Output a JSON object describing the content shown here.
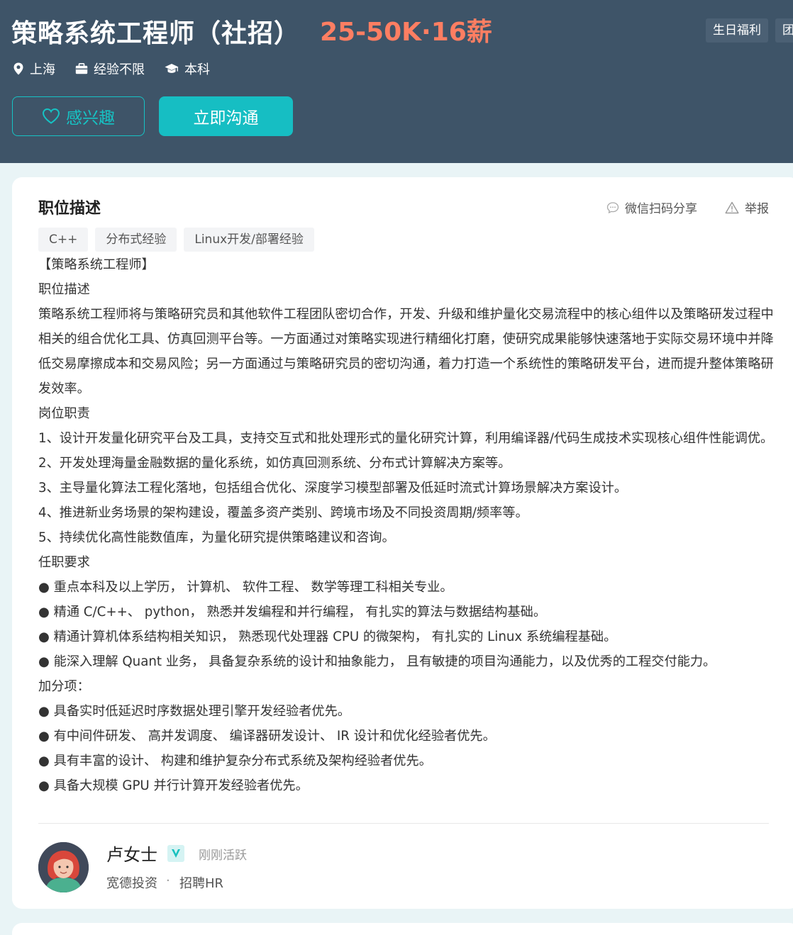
{
  "header": {
    "title": "策略系统工程师（社招）",
    "salary": "25-50K·16薪",
    "welfare_tags": [
      "生日福利",
      "团"
    ],
    "meta": {
      "location": "上海",
      "experience": "经验不限",
      "degree": "本科"
    },
    "buttons": {
      "interest": "感兴趣",
      "chat": "立即沟通"
    }
  },
  "job": {
    "section_title": "职位描述",
    "share": "微信扫码分享",
    "report": "举报",
    "skill_tags": [
      "C++",
      "分布式经验",
      "Linux开发/部署经验"
    ],
    "description": [
      "【策略系统工程师】",
      "职位描述",
      "策略系统工程师将与策略研究员和其他软件工程团队密切合作，开发、升级和维护量化交易流程中的核心组件以及策略研发过程中相关的组合优化工具、仿真回测平台等。一方面通过对策略实现进行精细化打磨，使研究成果能够快速落地于实际交易环境中并降低交易摩擦成本和交易风险；另一方面通过与策略研究员的密切沟通，着力打造一个系统性的策略研发平台，进而提升整体策略研发效率。",
      "岗位职责",
      "1、设计开发量化研究平台及工具，支持交互式和批处理形式的量化研究计算，利用编译器/代码生成技术实现核心组件性能调优。",
      "2、开发处理海量金融数据的量化系统，如仿真回测系统、分布式计算解决方案等。",
      "3、主导量化算法工程化落地，包括组合优化、深度学习模型部署及低延时流式计算场景解决方案设计。",
      "4、推进新业务场景的架构建设，覆盖多资产类别、跨境市场及不同投资周期/频率等。",
      "5、持续优化高性能数值库，为量化研究提供策略建议和咨询。",
      "任职要求",
      "● 重点本科及以上学历， 计算机、 软件工程、 数学等理工科相关专业。",
      "● 精通 C/C++、 python， 熟悉并发编程和并行编程， 有扎实的算法与数据结构基础。",
      "● 精通计算机体系结构相关知识， 熟悉现代处理器 CPU 的微架构， 有扎实的 Linux 系统编程基础。",
      "● 能深入理解 Quant 业务， 具备复杂系统的设计和抽象能力， 且有敏捷的项目沟通能力，以及优秀的工程交付能力。",
      "加分项：",
      "● 具备实时低延迟时序数据处理引擎开发经验者优先。",
      "● 有中间件研发、 高并发调度、 编译器研发设计、 IR 设计和优化经验者优先。",
      "● 具有丰富的设计、 构建和维护复杂分布式系统及架构经验者优先。",
      "● 具备大规模 GPU 并行计算开发经验者优先。"
    ]
  },
  "recruiter": {
    "name": "卢女士",
    "status": "刚刚活跃",
    "company": "宽德投资",
    "separator": "·",
    "role": "招聘HR"
  },
  "colors": {
    "header_bg": "#3e5468",
    "accent": "#16bec3",
    "salary": "#fe7e62"
  }
}
